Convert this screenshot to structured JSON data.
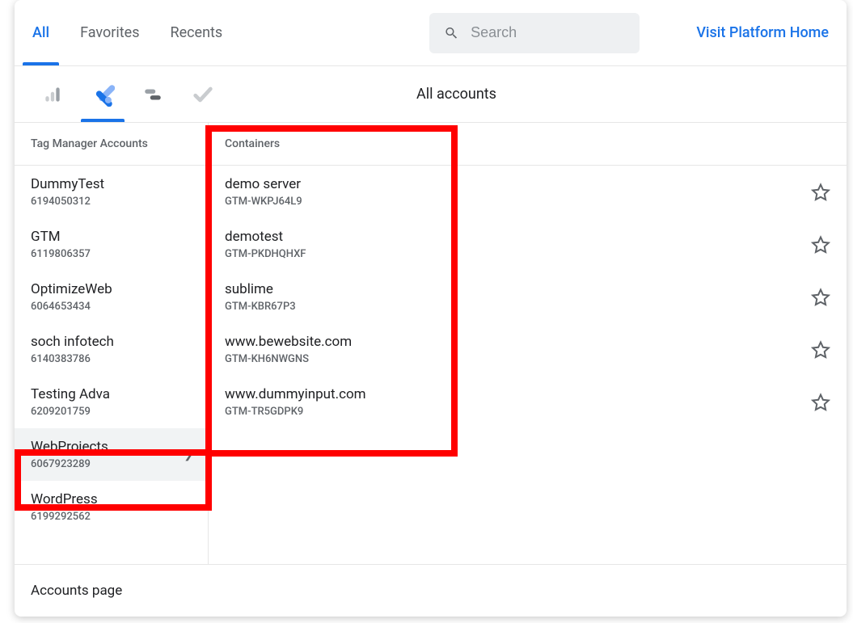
{
  "tabs": {
    "all": "All",
    "favorites": "Favorites",
    "recents": "Recents"
  },
  "search": {
    "placeholder": "Search"
  },
  "visit_link": "Visit Platform Home",
  "products_title": "All accounts",
  "col_titles": {
    "accounts": "Tag Manager Accounts",
    "containers": "Containers"
  },
  "accounts": [
    {
      "name": "DummyTest",
      "id": "6194050312"
    },
    {
      "name": "GTM",
      "id": "6119806357"
    },
    {
      "name": "OptimizeWeb",
      "id": "6064653434"
    },
    {
      "name": "soch infotech",
      "id": "6140383786"
    },
    {
      "name": "Testing Adva",
      "id": "6209201759"
    },
    {
      "name": "WebProjects",
      "id": "6067923289"
    },
    {
      "name": "WordPress",
      "id": "6199292562"
    }
  ],
  "selected_account_index": 5,
  "containers": [
    {
      "name": "demo server",
      "id": "GTM-WKPJ64L9"
    },
    {
      "name": "demotest",
      "id": "GTM-PKDHQHXF"
    },
    {
      "name": "sublime",
      "id": "GTM-KBR67P3"
    },
    {
      "name": "www.bewebsite.com",
      "id": "GTM-KH6NWGNS"
    },
    {
      "name": "www.dummyinput.com",
      "id": "GTM-TR5GDPK9"
    }
  ],
  "footer": "Accounts page"
}
